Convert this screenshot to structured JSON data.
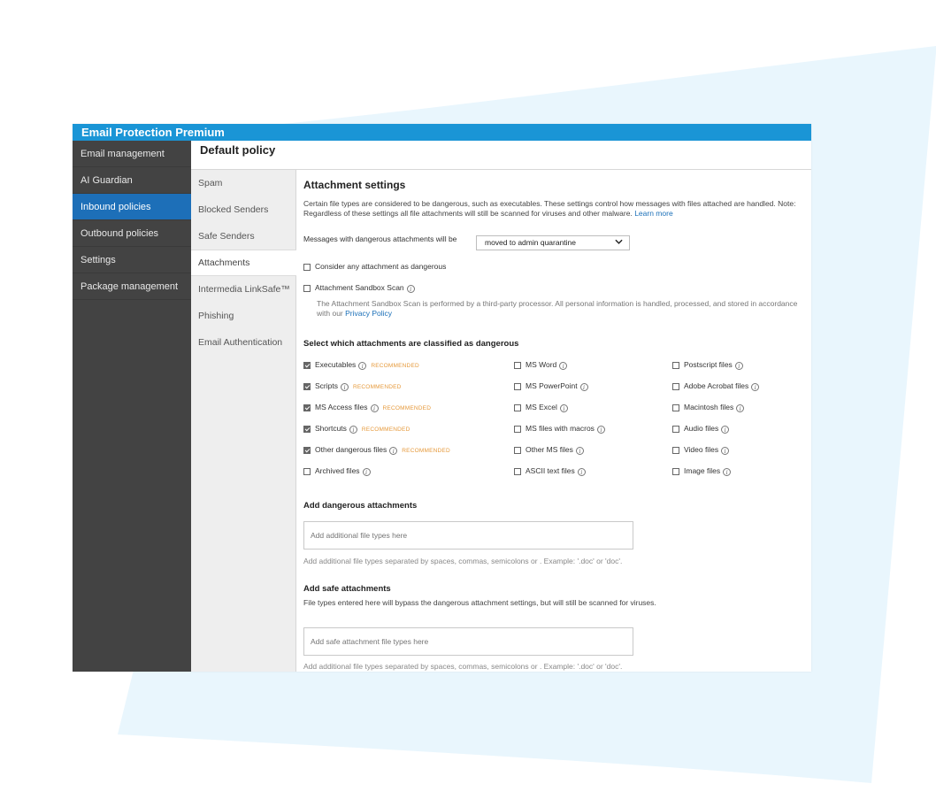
{
  "window": {
    "title": "Email Protection Premium"
  },
  "sidebar": {
    "items": [
      {
        "label": "Email management",
        "active": false
      },
      {
        "label": "AI Guardian",
        "active": false
      },
      {
        "label": "Inbound policies",
        "active": true
      },
      {
        "label": "Outbound policies",
        "active": false
      },
      {
        "label": "Settings",
        "active": false
      },
      {
        "label": "Package management",
        "active": false
      }
    ]
  },
  "header": {
    "title": "Default policy"
  },
  "subnav": {
    "items": [
      {
        "label": "Spam"
      },
      {
        "label": "Blocked Senders"
      },
      {
        "label": "Safe Senders"
      },
      {
        "label": "Attachments"
      },
      {
        "label": "Intermedia LinkSafe™"
      },
      {
        "label": "Phishing"
      },
      {
        "label": "Email Authentication"
      }
    ]
  },
  "attachment_settings": {
    "title": "Attachment settings",
    "description": "Certain file types are considered to be dangerous, such as executables. These settings control how messages with files attached are handled. Note: Regardless of these settings all file attachments will still be scanned for viruses and other malware.",
    "learn_more": "Learn more",
    "messages_label": "Messages with dangerous attachments will be",
    "messages_value": "moved to admin quarantine",
    "consider_any_label": "Consider any attachment as dangerous",
    "sandbox_label": "Attachment Sandbox Scan",
    "sandbox_note": "The Attachment Sandbox Scan is performed by a third-party processor. All personal information is handled, processed, and stored in accordance with our",
    "privacy_policy": "Privacy Policy"
  },
  "dangerous_section": {
    "title": "Select which attachments are classified as dangerous",
    "recommended_label": "RECOMMENDED",
    "col1": [
      {
        "label": "Executables",
        "checked": true,
        "recommended": true
      },
      {
        "label": "Scripts",
        "checked": true,
        "recommended": true
      },
      {
        "label": "MS Access files",
        "checked": true,
        "recommended": true
      },
      {
        "label": "Shortcuts",
        "checked": true,
        "recommended": true
      },
      {
        "label": "Other dangerous files",
        "checked": true,
        "recommended": true
      },
      {
        "label": "Archived files",
        "checked": false,
        "recommended": false
      }
    ],
    "col2": [
      {
        "label": "MS Word",
        "checked": false
      },
      {
        "label": "MS PowerPoint",
        "checked": false
      },
      {
        "label": "MS Excel",
        "checked": false
      },
      {
        "label": "MS files with macros",
        "checked": false
      },
      {
        "label": "Other MS files",
        "checked": false
      },
      {
        "label": "ASCII text files",
        "checked": false
      }
    ],
    "col3": [
      {
        "label": "Postscript files",
        "checked": false
      },
      {
        "label": "Adobe Acrobat files",
        "checked": false
      },
      {
        "label": "Macintosh files",
        "checked": false
      },
      {
        "label": "Audio files",
        "checked": false
      },
      {
        "label": "Video files",
        "checked": false
      },
      {
        "label": "Image files",
        "checked": false
      }
    ]
  },
  "add_dangerous": {
    "title": "Add dangerous attachments",
    "placeholder": "Add additional file types here",
    "hint": "Add additional file types separated by spaces, commas, semicolons or . Example: '.doc' or 'doc'."
  },
  "add_safe": {
    "title": "Add safe attachments",
    "description": "File types entered here will bypass the dangerous attachment settings, but will still be scanned for viruses.",
    "placeholder": "Add safe attachment file types here",
    "hint": "Add additional file types separated by spaces, commas, semicolons or . Example: '.doc' or 'doc'."
  },
  "colors": {
    "titlebar": "#1a95d6",
    "sidebar_bg": "#434343",
    "sidebar_active": "#1d6fb8",
    "recommended": "#e69a3c",
    "background_shape": "#e9f6fd"
  }
}
